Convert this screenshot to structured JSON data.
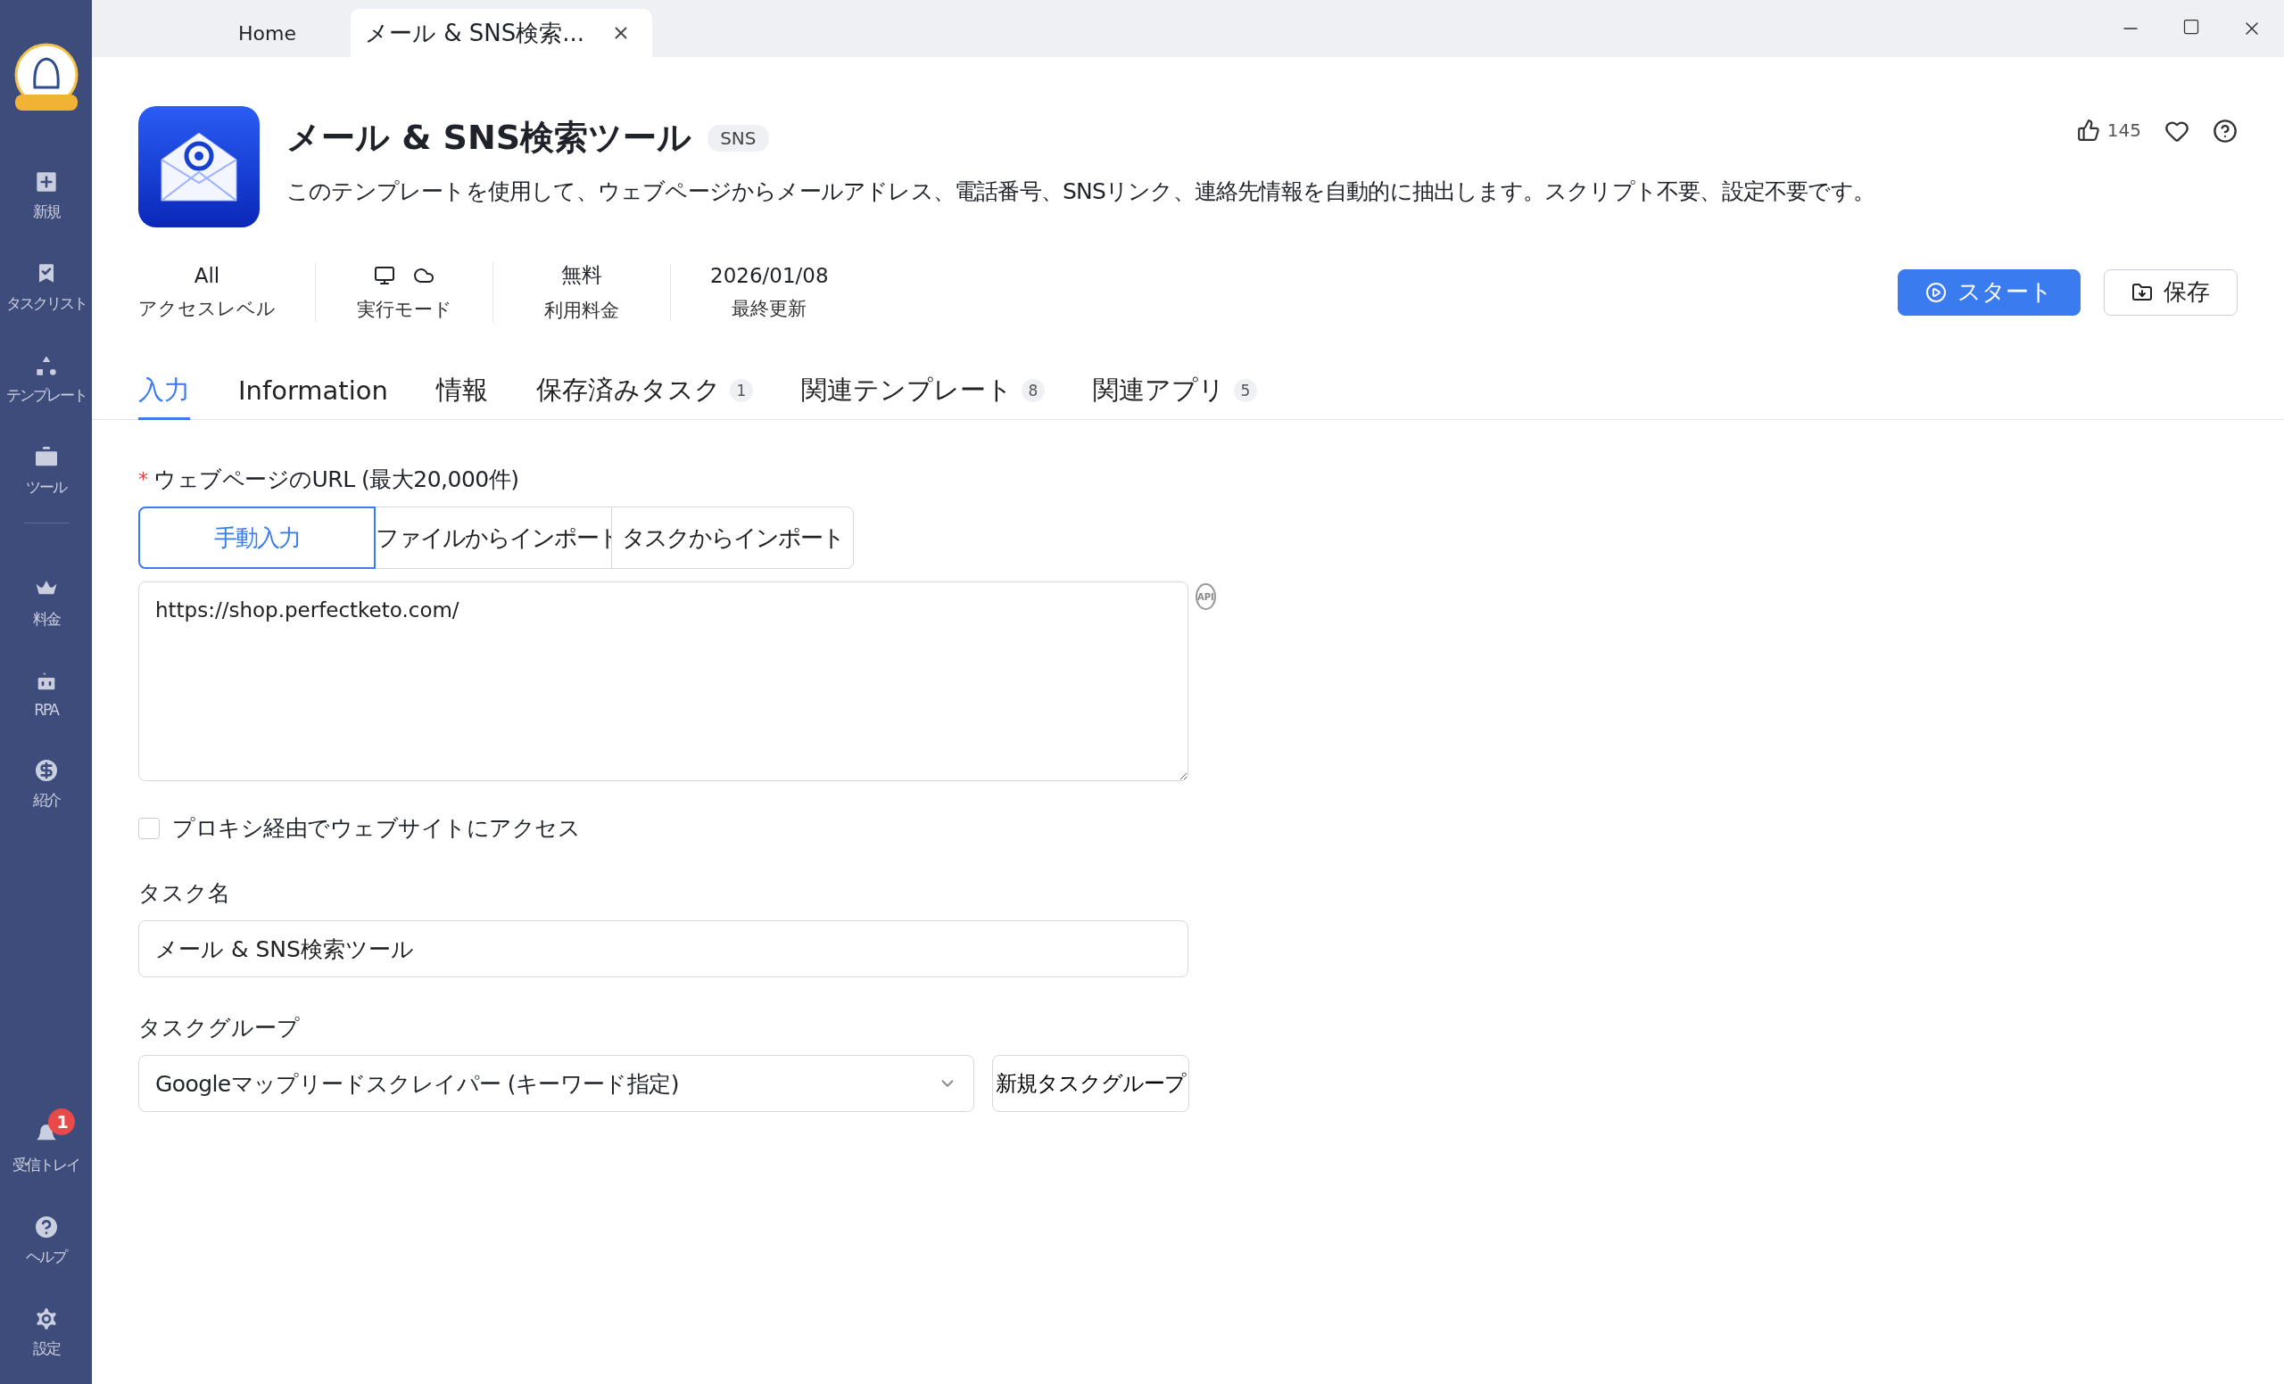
{
  "window_tabs": [
    {
      "label": "Home",
      "selected": false
    },
    {
      "label": "メール & SNS検索...",
      "selected": true
    }
  ],
  "sidebar": {
    "items": [
      {
        "label": "新規"
      },
      {
        "label": "タスクリスト"
      },
      {
        "label": "テンプレート"
      },
      {
        "label": "ツール"
      }
    ],
    "items_after_divider": [
      {
        "label": "料金"
      },
      {
        "label": "RPA"
      },
      {
        "label": "紹介"
      }
    ],
    "bottom_items": [
      {
        "label": "受信トレイ",
        "badge": "1"
      },
      {
        "label": "ヘルプ"
      },
      {
        "label": "設定"
      }
    ]
  },
  "header": {
    "title": "メール & SNS検索ツール",
    "tag": "SNS",
    "description": "このテンプレートを使用して、ウェブページからメールアドレス、電話番号、SNSリンク、連絡先情報を自動的に抽出します。スクリプト不要、設定不要です。",
    "likes": "145"
  },
  "meta": [
    {
      "kind": "text",
      "value": "All",
      "label": "アクセスレベル"
    },
    {
      "kind": "icons",
      "label": "実行モード"
    },
    {
      "kind": "text",
      "value": "無料",
      "label": "利用料金"
    },
    {
      "kind": "text",
      "value": "2026/01/08",
      "label": "最終更新"
    }
  ],
  "actions": {
    "start": "スタート",
    "save": "保存"
  },
  "tabs": [
    {
      "label": "入力",
      "selected": true
    },
    {
      "label": "Information",
      "selected": false
    },
    {
      "label": "情報",
      "selected": false
    },
    {
      "label": "保存済みタスク",
      "count": "1",
      "selected": false
    },
    {
      "label": "関連テンプレート",
      "count": "8",
      "selected": false
    },
    {
      "label": "関連アプリ",
      "count": "5",
      "selected": false
    }
  ],
  "form": {
    "url_label": "ウェブページのURL (最大20,000件)",
    "required_mark": "*",
    "input_modes": [
      {
        "label": "手動入力",
        "selected": true
      },
      {
        "label": "ファイルからインポート",
        "selected": false
      },
      {
        "label": "タスクからインポート",
        "selected": false
      }
    ],
    "url_value": "https://shop.perfectketo.com/",
    "api_badge": "API",
    "proxy": {
      "label": "プロキシ経由でウェブサイトにアクセス",
      "checked": false
    },
    "task_name_label": "タスク名",
    "task_name_value": "メール & SNS検索ツール",
    "task_group_label": "タスクグループ",
    "task_group_value": "Googleマップリードスクレイパー (キーワード指定)",
    "new_group_button": "新規タスクグループ"
  }
}
